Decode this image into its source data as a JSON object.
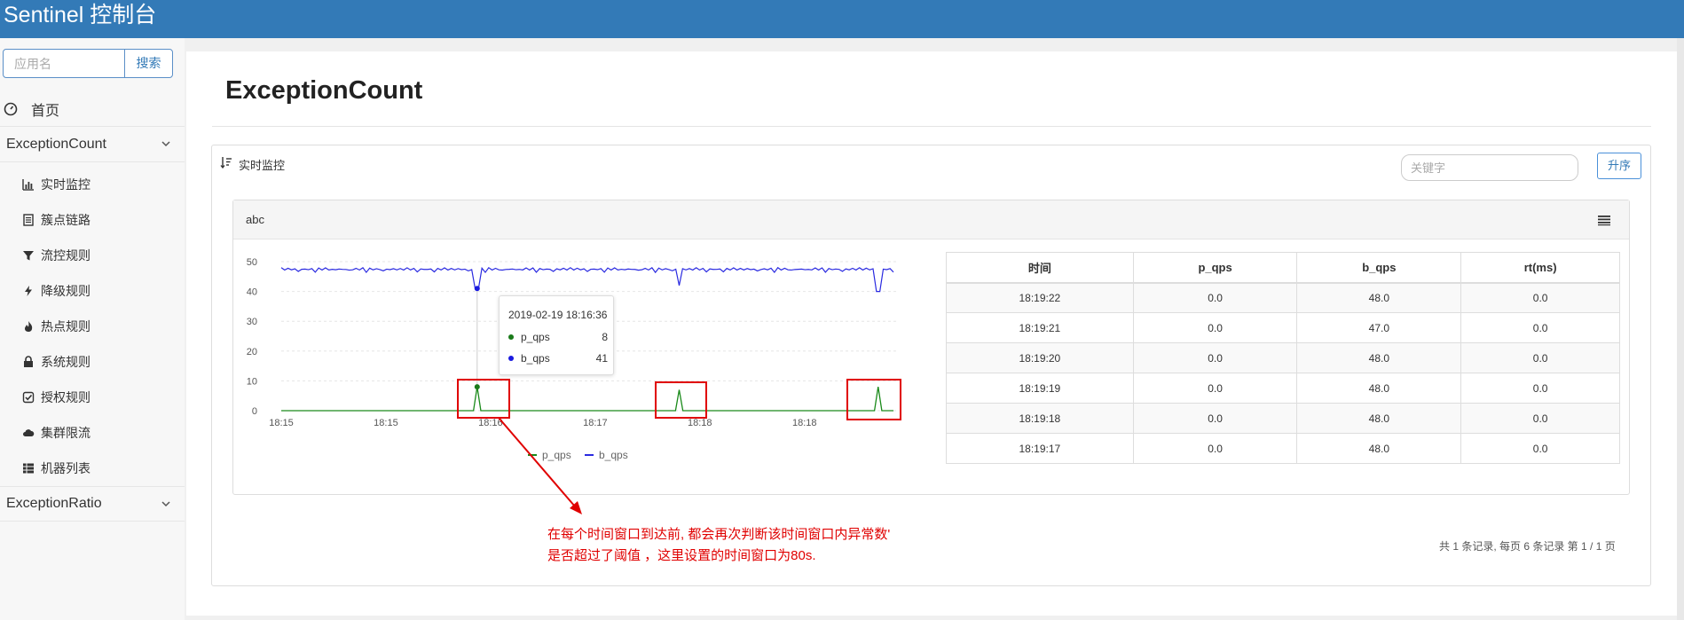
{
  "app": {
    "title": "Sentinel 控制台"
  },
  "sidebar": {
    "search": {
      "placeholder": "应用名",
      "button": "搜索"
    },
    "home_label": "首页",
    "groups": [
      {
        "label": "ExceptionCount",
        "expanded": true
      },
      {
        "label": "ExceptionRatio",
        "expanded": false
      }
    ],
    "items": [
      {
        "label": "实时监控",
        "icon": "bar-chart-icon"
      },
      {
        "label": "簇点链路",
        "icon": "list-icon"
      },
      {
        "label": "流控规则",
        "icon": "filter-icon"
      },
      {
        "label": "降级规则",
        "icon": "bolt-icon"
      },
      {
        "label": "热点规则",
        "icon": "fire-icon"
      },
      {
        "label": "系统规则",
        "icon": "lock-icon"
      },
      {
        "label": "授权规则",
        "icon": "check-square-icon"
      },
      {
        "label": "集群限流",
        "icon": "cloud-icon"
      },
      {
        "label": "机器列表",
        "icon": "grid-icon"
      }
    ]
  },
  "page": {
    "title": "ExceptionCount",
    "panel_title": "实时监控",
    "keyword_placeholder": "关键字",
    "sort_button": "升序",
    "resource_name": "abc",
    "pager": "共 1 条记录, 每页 6 条记录 第 1 / 1 页"
  },
  "tooltip": {
    "time": "2019-02-19 18:16:36",
    "rows": [
      {
        "name": "p_qps",
        "value": "8",
        "color": "#1a7a1a"
      },
      {
        "name": "b_qps",
        "value": "41",
        "color": "#1a1adf"
      }
    ]
  },
  "chart_data": {
    "type": "line",
    "y_ticks": [
      "50",
      "40",
      "30",
      "20",
      "10",
      "0"
    ],
    "ylim": [
      0,
      50
    ],
    "x_ticks": [
      "18:15",
      "18:15",
      "18:16",
      "18:17",
      "18:18",
      "18:18"
    ],
    "grid": true,
    "legend_position": "bottom",
    "series": [
      {
        "name": "p_qps",
        "color": "#1a8a1a",
        "baseline": 0,
        "spikes": [
          {
            "x": 0.32,
            "value": 8
          },
          {
            "x": 0.65,
            "value": 7
          },
          {
            "x": 0.975,
            "value": 8
          }
        ]
      },
      {
        "name": "b_qps",
        "color": "#2a2ae0",
        "baseline": 48,
        "dips": [
          {
            "x": 0.32,
            "value": 41
          },
          {
            "x": 0.65,
            "value": 42
          },
          {
            "x": 0.975,
            "value": 40
          }
        ]
      }
    ]
  },
  "table": {
    "headers": [
      "时间",
      "p_qps",
      "b_qps",
      "rt(ms)"
    ],
    "rows": [
      [
        "18:19:22",
        "0.0",
        "48.0",
        "0.0"
      ],
      [
        "18:19:21",
        "0.0",
        "47.0",
        "0.0"
      ],
      [
        "18:19:20",
        "0.0",
        "48.0",
        "0.0"
      ],
      [
        "18:19:19",
        "0.0",
        "48.0",
        "0.0"
      ],
      [
        "18:19:18",
        "0.0",
        "48.0",
        "0.0"
      ],
      [
        "18:19:17",
        "0.0",
        "48.0",
        "0.0"
      ]
    ]
  },
  "annotation": {
    "line1": "在每个时间窗口到达前, 都会再次判断该时间窗口内异常数'",
    "line2": "是否超过了阈值 ，这里设置的时间窗口为80s.",
    "color": "#e00000"
  },
  "colors": {
    "brand": "#337ab7",
    "accent_border": "#4a90d9"
  }
}
